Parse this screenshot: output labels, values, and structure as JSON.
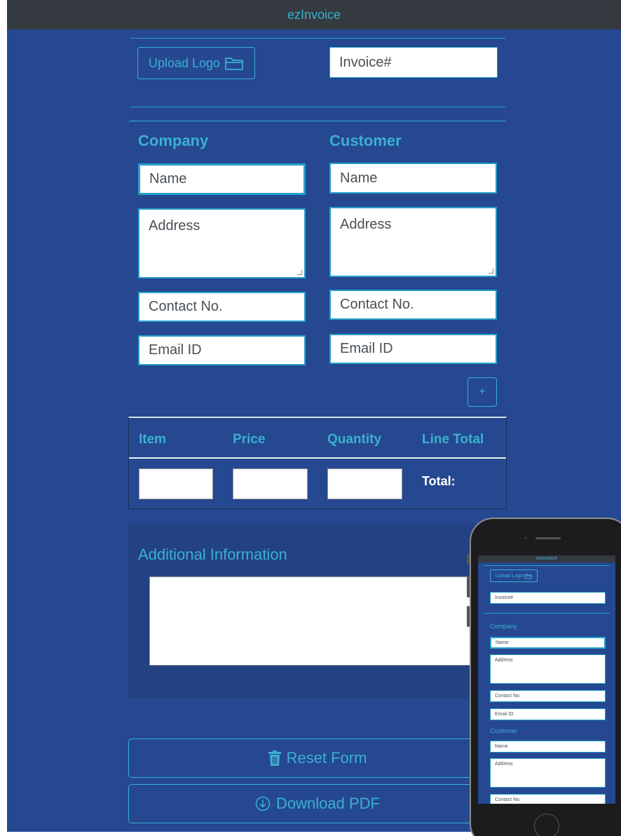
{
  "app": {
    "title": "ezInvoice"
  },
  "header": {
    "upload_logo_label": "Upload Logo",
    "invoice_placeholder": "Invoice#"
  },
  "company": {
    "heading": "Company",
    "name_placeholder": "Name",
    "address_placeholder": "Address",
    "contact_placeholder": "Contact No.",
    "email_placeholder": "Email ID"
  },
  "customer": {
    "heading": "Customer",
    "name_placeholder": "Name",
    "address_placeholder": "Address",
    "contact_placeholder": "Contact No.",
    "email_placeholder": "Email ID"
  },
  "add_button_label": "+",
  "table": {
    "headers": [
      "Item",
      "Price",
      "Quantity",
      "Line Total"
    ],
    "total_label": "Total:"
  },
  "additional": {
    "heading": "Additional Information"
  },
  "actions": {
    "reset_label": "Reset Form",
    "download_label": "Download PDF"
  },
  "mobile": {
    "title": "ezInvoice",
    "upload_logo_label": "Upload Logo",
    "invoice_placeholder": "Invoice#",
    "company_heading": "Company",
    "company_name": "Name",
    "company_address": "Address",
    "company_contact": "Contact No.",
    "company_email": "Email ID",
    "customer_heading": "Customer",
    "customer_name": "Name",
    "customer_address": "Address",
    "customer_contact": "Contact No."
  },
  "colors": {
    "background": "#254891",
    "accent": "#3bb0cf",
    "titlebar": "#343a40"
  },
  "icons": {
    "upload": "folder-icon",
    "reset": "trash-icon",
    "download": "download-circle-icon"
  }
}
